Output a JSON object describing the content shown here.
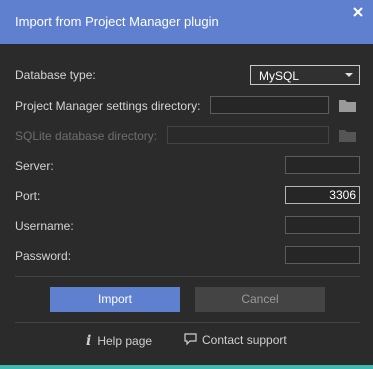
{
  "dialog": {
    "title": "Import from Project Manager plugin"
  },
  "form": {
    "database_type_label": "Database type:",
    "database_type_value": "MySQL",
    "pm_settings_dir_label": "Project Manager settings directory:",
    "pm_settings_dir_value": "",
    "sqlite_dir_label": "SQLite database directory:",
    "sqlite_dir_value": "",
    "server_label": "Server:",
    "server_value": "",
    "port_label": "Port:",
    "port_value": "3306",
    "username_label": "Username:",
    "username_value": "",
    "password_label": "Password:",
    "password_value": ""
  },
  "buttons": {
    "import_label": "Import",
    "cancel_label": "Cancel"
  },
  "footer": {
    "help_label": "Help page",
    "support_label": "Contact support"
  },
  "colors": {
    "accent": "#5f7fcf",
    "background": "#2b2b2b",
    "bottom_bar": "#3fb8b2"
  },
  "icons": {
    "close": "close-icon",
    "folder": "folder-icon",
    "info": "info-icon",
    "chat": "chat-bubble-icon",
    "dropdown": "chevron-down-icon"
  }
}
